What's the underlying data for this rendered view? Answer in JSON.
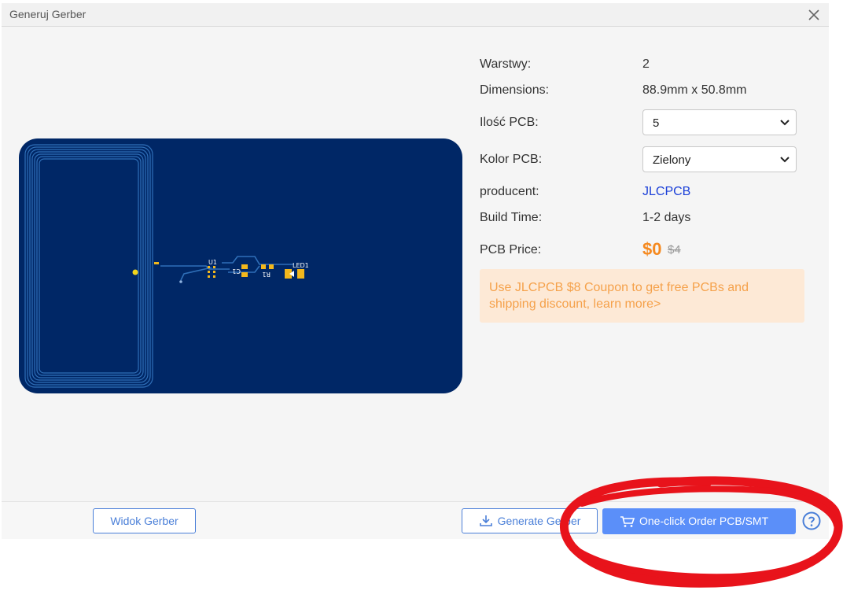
{
  "dialog": {
    "title": "Generuj Gerber"
  },
  "info": {
    "layers": {
      "label": "Warstwy:",
      "value": "2"
    },
    "dimensions": {
      "label": "Dimensions:",
      "value": "88.9mm x 50.8mm"
    },
    "quantity": {
      "label": "Ilość PCB:",
      "value": "5"
    },
    "color": {
      "label": "Kolor PCB:",
      "value": "Zielony"
    },
    "manufacturer": {
      "label": "producent:",
      "value": "JLCPCB"
    },
    "build_time": {
      "label": "Build Time:",
      "value": "1-2 days"
    },
    "price": {
      "label": "PCB Price:",
      "value": "$0",
      "old_value": "$4"
    }
  },
  "coupon": {
    "text": "Use JLCPCB $8 Coupon to get free PCBs and shipping discount, learn more>"
  },
  "footer": {
    "gerber_view_label": "Widok Gerber",
    "generate_label": "Generate Gerber",
    "order_label": "One-click Order PCB/SMT"
  },
  "pcb": {
    "labels": {
      "u1": "U1",
      "c1": "C1",
      "r1": "R1",
      "led1": "LED1"
    },
    "board_color": "#002766",
    "trace_color": "#2f6fb8",
    "pad_color": "#f2b71c"
  },
  "colors": {
    "accent": "#5b8ff9",
    "price": "#f5891f",
    "annotation": "#e8131b"
  }
}
